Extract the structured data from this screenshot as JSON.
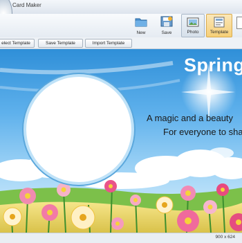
{
  "window": {
    "title": "Card Maker"
  },
  "ribbon": {
    "new_label": "New",
    "save_label": "Save",
    "photo_label": "Photo",
    "template_label": "Template"
  },
  "template_bar": {
    "select_label": "elect Template",
    "save_label": "Save Template",
    "import_label": "Import Template"
  },
  "card": {
    "title": "Spring",
    "line1": "A magic and a beauty",
    "line2": "For everyone to share"
  },
  "status": {
    "canvas_size": "900 x 624"
  },
  "colors": {
    "sky_top": "#2f8fd8",
    "title_text": "#ffffff",
    "frame_border": "#bfe2f8"
  }
}
